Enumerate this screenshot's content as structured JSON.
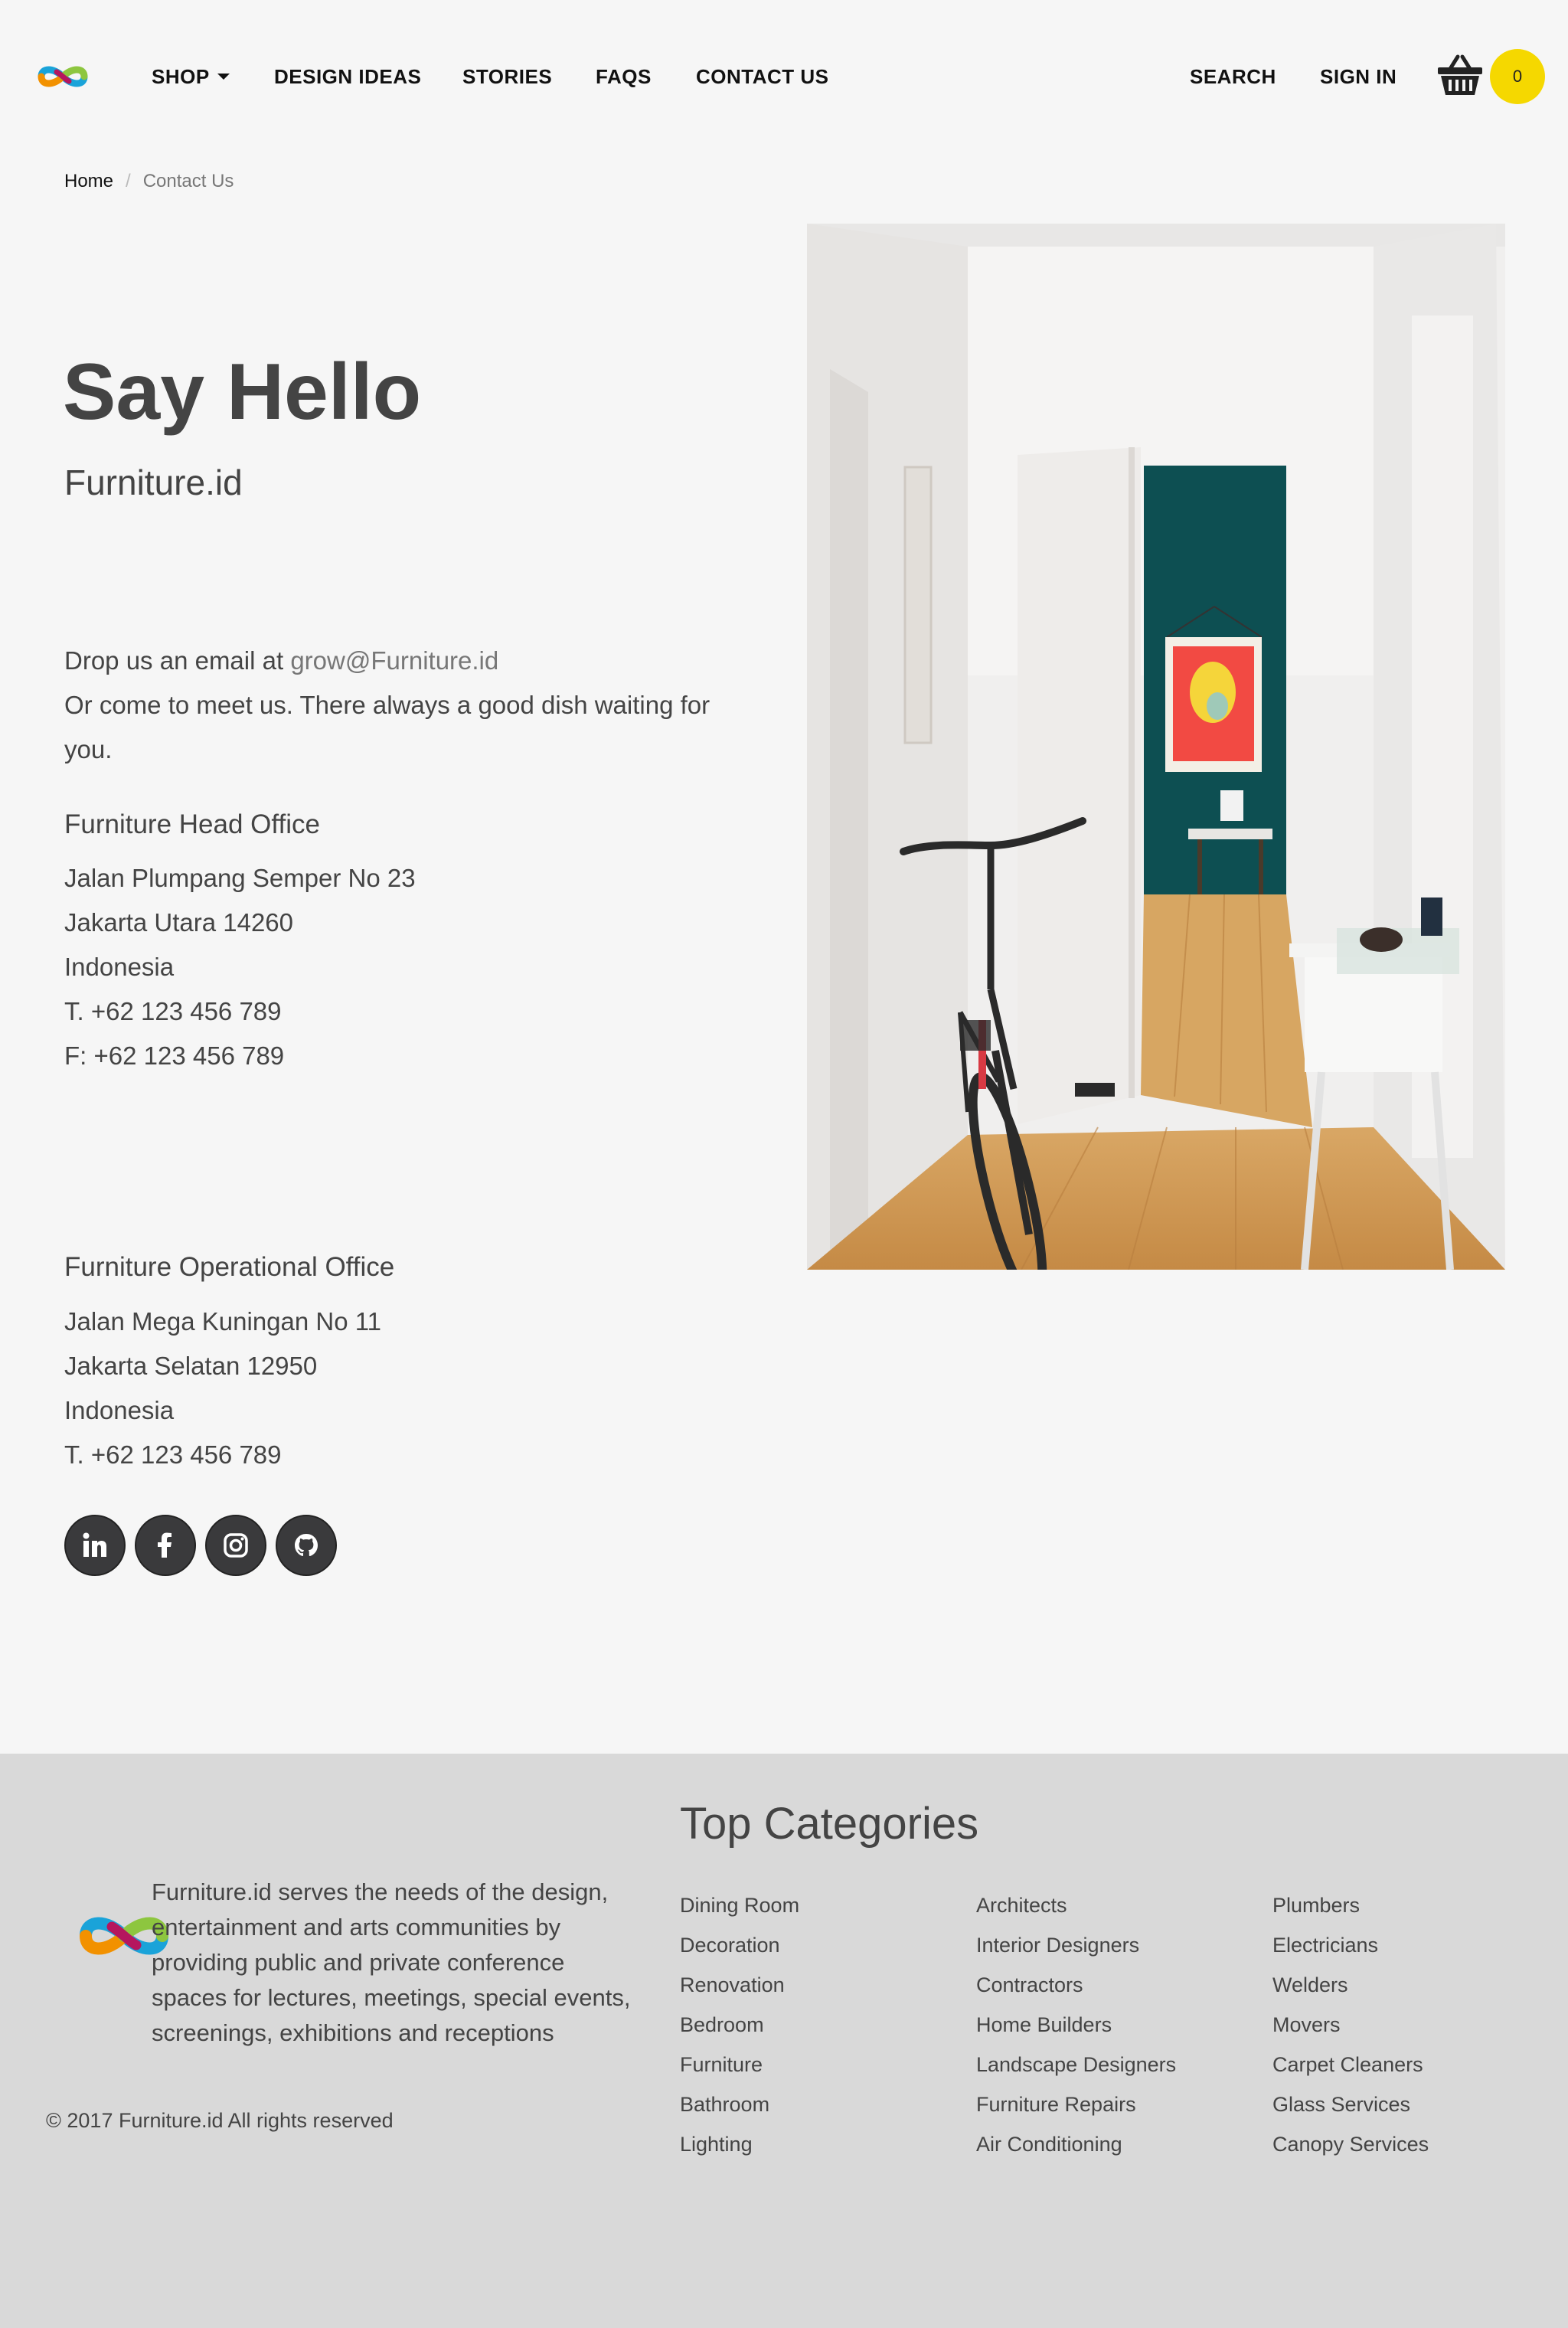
{
  "nav": {
    "items": [
      {
        "label": "SHOP"
      },
      {
        "label": "DESIGN IDEAS"
      },
      {
        "label": "STORIES"
      },
      {
        "label": "FAQS"
      },
      {
        "label": "CONTACT US"
      }
    ],
    "search_label": "SEARCH",
    "signin_label": "SIGN IN",
    "cart_count": "0",
    "cart_badge_color": "#f5d800"
  },
  "breadcrumb": {
    "home": "Home",
    "separator": "/",
    "current": "Contact Us"
  },
  "contact": {
    "title": "Say Hello",
    "subtitle": "Furniture.id",
    "email_prefix": "Drop us an email at ",
    "email": "grow@Furniture.id",
    "meet_text": "Or come to meet us. There always a good dish waiting for you.",
    "head_office": {
      "title": "Furniture Head Office",
      "lines": [
        "Jalan Plumpang Semper No 23",
        "Jakarta Utara 14260",
        "Indonesia",
        "T. +62 123 456 789",
        "F: +62 123 456 789"
      ]
    },
    "operational_office": {
      "title": "Furniture Operational Office",
      "lines": [
        "Jalan Mega Kuningan No 11",
        "Jakarta Selatan 12950",
        "Indonesia",
        "T. +62 123 456 789"
      ]
    },
    "socials": [
      "linkedin-icon",
      "facebook-icon",
      "instagram-icon",
      "github-icon"
    ]
  },
  "footer": {
    "about": "Furniture.id serves the needs of the design, entertainment and arts communities by providing public and private conference spaces for lectures, meetings, special events, screenings, exhibitions and receptions",
    "copyright": "© 2017 Furniture.id All rights reserved",
    "categories_title": "Top Categories",
    "categories": [
      [
        "Dining Room",
        "Decoration",
        "Renovation",
        "Bedroom",
        "Furniture",
        "Bathroom",
        "Lighting"
      ],
      [
        "Architects",
        "Interior Designers",
        "Contractors",
        "Home Builders",
        "Landscape Designers",
        "Furniture Repairs",
        "Air Conditioning"
      ],
      [
        "Plumbers",
        "Electricians",
        "Welders",
        "Movers",
        "Carpet Cleaners",
        "Glass Services",
        "Canopy Services"
      ]
    ]
  }
}
